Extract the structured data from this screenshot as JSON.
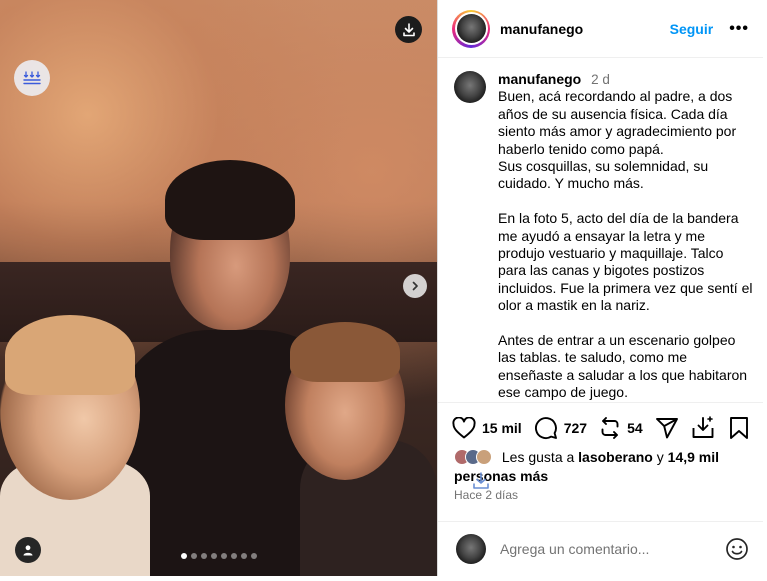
{
  "post": {
    "username": "manufanego",
    "follow_label": "Seguir",
    "more_label": "•••",
    "caption": {
      "username": "manufanego",
      "time": "2 d",
      "paragraphs": [
        [
          "Buen, acá recordando al padre, a dos",
          "años de su ausencia física. Cada día",
          "siento más amor y agradecimiento por",
          "haberlo tenido como papá.",
          "Sus cosquillas, su solemnidad, su",
          "cuidado. Y mucho más."
        ],
        [
          "En la foto 5, acto del día de la bandera",
          "me ayudó a ensayar la letra y me",
          "produjo vestuario y maquillaje. Talco",
          "para las canas y bigotes postizos",
          "incluidos. Fue la primera vez que sentí el",
          "olor a mastik en la nariz."
        ],
        [
          "Antes de entrar a un escenario golpeo",
          "las tablas. te saludo, como me",
          "enseñaste a saludar a los que habitaron",
          "ese campo de juego."
        ]
      ]
    },
    "actions": {
      "likes_count": "15 mil",
      "comments_count": "727",
      "reposts_count": "54"
    },
    "liked_by": {
      "prefix": "Les gusta a",
      "user": "lasoberano",
      "connector": "y",
      "others_line1": "14,9 mil",
      "others_line2": "personas más"
    },
    "time_ago": "Hace 2 días",
    "comment_placeholder": "Agrega un comentario..."
  },
  "media": {
    "slide_count": 8,
    "active_slide": 1
  },
  "colors": {
    "accent": "#0095f6",
    "secondary_text": "#737373",
    "border": "#dbdbdb"
  },
  "icons": [
    "download-icon",
    "flatten-icon",
    "chevron-right-icon",
    "user-tag-icon",
    "heart-icon",
    "comment-icon",
    "repost-icon",
    "share-icon",
    "download-tray-icon",
    "bookmark-icon",
    "emoji-icon"
  ]
}
